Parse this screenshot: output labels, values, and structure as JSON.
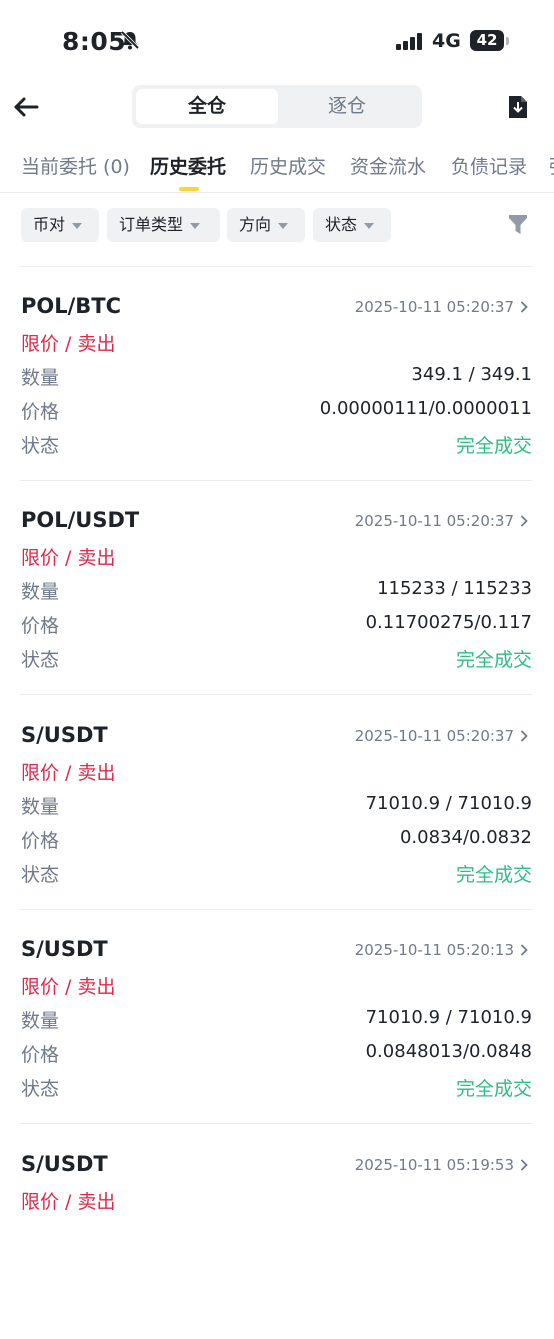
{
  "status_bar": {
    "time": "8:05",
    "network": "4G",
    "battery": "42"
  },
  "header": {
    "segments": [
      "全仓",
      "逐仓"
    ],
    "active_segment": "全仓"
  },
  "tabs": [
    "当前委托 (0)",
    "历史委托",
    "历史成交",
    "资金流水",
    "负债记录",
    "强"
  ],
  "active_tab": "历史委托",
  "filters": [
    "币对",
    "订单类型",
    "方向",
    "状态"
  ],
  "labels": {
    "quantity": "数量",
    "price": "价格",
    "status": "状态"
  },
  "orders": [
    {
      "pair": "POL/BTC",
      "datetime": "2025-10-11 05:20:37",
      "side": "限价 / 卖出",
      "quantity": "349.1 / 349.1",
      "price": "0.00000111/0.0000011",
      "status": "完全成交"
    },
    {
      "pair": "POL/USDT",
      "datetime": "2025-10-11 05:20:37",
      "side": "限价 / 卖出",
      "quantity": "115233 / 115233",
      "price": "0.11700275/0.117",
      "status": "完全成交"
    },
    {
      "pair": "S/USDT",
      "datetime": "2025-10-11 05:20:37",
      "side": "限价 / 卖出",
      "quantity": "71010.9 / 71010.9",
      "price": "0.0834/0.0832",
      "status": "完全成交"
    },
    {
      "pair": "S/USDT",
      "datetime": "2025-10-11 05:20:13",
      "side": "限价 / 卖出",
      "quantity": "71010.9 / 71010.9",
      "price": "0.0848013/0.0848",
      "status": "完全成交"
    },
    {
      "pair": "S/USDT",
      "datetime": "2025-10-11 05:19:53",
      "side": "限价 / 卖出"
    }
  ],
  "colors": {
    "accent": "#fcd535",
    "sell": "#e0294a",
    "filled": "#2ebd85",
    "muted": "#707a8a"
  }
}
